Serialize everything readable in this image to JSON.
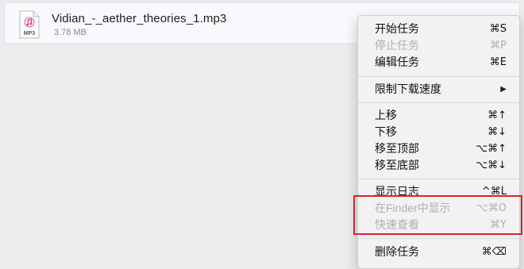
{
  "task": {
    "file_icon_type": "MP3",
    "file_name": "Vidian_-_aether_theories_1.mp3",
    "file_size": "3.78 MB",
    "file_icon": "mp3-file-icon"
  },
  "context_menu": {
    "items": [
      {
        "label": "开始任务",
        "shortcut": "⌘S",
        "enabled": true
      },
      {
        "label": "停止任务",
        "shortcut": "⌘P",
        "enabled": false
      },
      {
        "label": "编辑任务",
        "shortcut": "⌘E",
        "enabled": true
      },
      {
        "label": "限制下载速度",
        "shortcut": "▶",
        "enabled": true,
        "submenu": true
      },
      {
        "label": "上移",
        "shortcut": "⌘↑",
        "enabled": true
      },
      {
        "label": "下移",
        "shortcut": "⌘↓",
        "enabled": true
      },
      {
        "label": "移至顶部",
        "shortcut": "⌥⌘↑",
        "enabled": true
      },
      {
        "label": "移至底部",
        "shortcut": "⌥⌘↓",
        "enabled": true
      },
      {
        "label": "显示日志",
        "shortcut": "^⌘L",
        "enabled": true
      },
      {
        "label": "在Finder中显示",
        "shortcut": "⌥⌘O",
        "enabled": false
      },
      {
        "label": "快速查看",
        "shortcut": "⌘Y",
        "enabled": false
      },
      {
        "label": "删除任务",
        "shortcut": "⌘⌫",
        "enabled": true
      }
    ]
  },
  "colors": {
    "highlight_border": "#d8252a",
    "disabled_text": "#b0b0b0",
    "menu_background": "#f2f2f2"
  }
}
